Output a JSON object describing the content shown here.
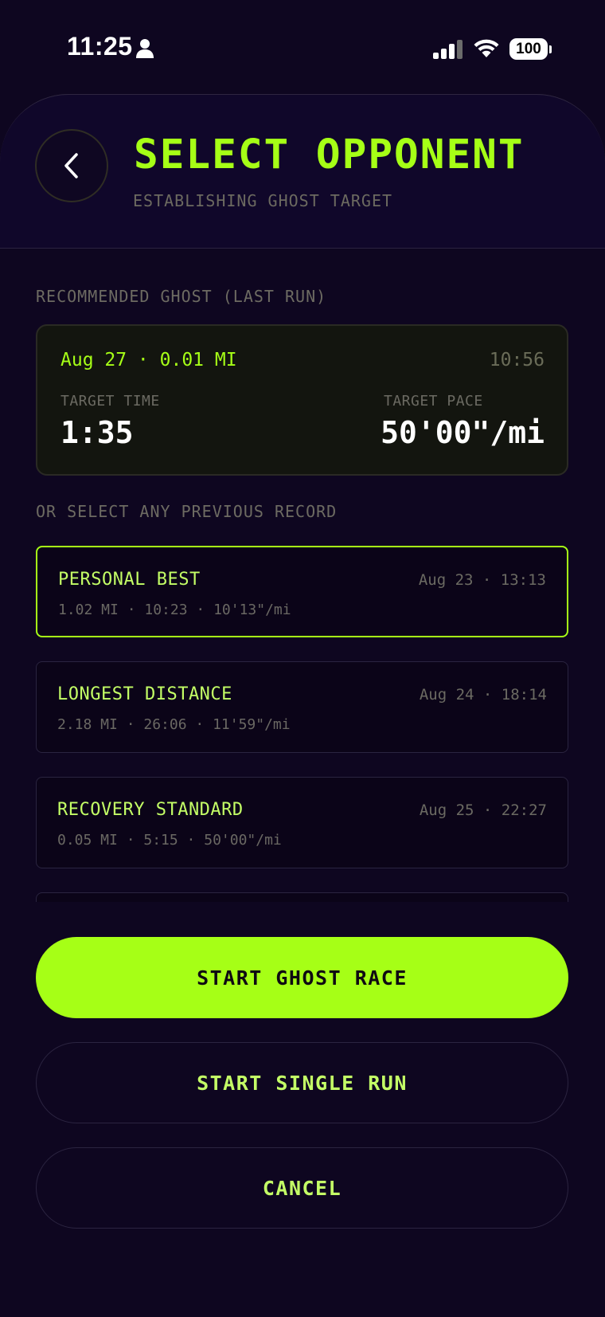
{
  "status_bar": {
    "time": "11:25",
    "battery": "100",
    "icons": [
      "person-icon",
      "cellular-signal-icon",
      "wifi-icon",
      "battery-icon"
    ]
  },
  "header": {
    "title": "SELECT OPPONENT",
    "subtitle": "ESTABLISHING GHOST TARGET",
    "back_icon": "chevron-left-icon"
  },
  "recommended": {
    "section_label": "RECOMMENDED GHOST (LAST RUN)",
    "date_distance": "Aug 27 · 0.01 MI",
    "duration": "10:56",
    "target_time_label": "TARGET TIME",
    "target_time": "1:35",
    "target_pace_label": "TARGET PACE",
    "target_pace": "50'00\"/mi"
  },
  "records": {
    "section_label": "OR SELECT ANY PREVIOUS RECORD",
    "items": [
      {
        "name": "PERSONAL BEST",
        "when": "Aug 23 · 13:13",
        "stats": "1.02 MI · 10:23 · 10'13\"/mi",
        "selected": true
      },
      {
        "name": "LONGEST DISTANCE",
        "when": "Aug 24 · 18:14",
        "stats": "2.18 MI · 26:06 · 11'59\"/mi",
        "selected": false
      },
      {
        "name": "RECOVERY STANDARD",
        "when": "Aug 25 · 22:27",
        "stats": "0.05 MI · 5:15 · 50'00\"/mi",
        "selected": false
      }
    ]
  },
  "actions": {
    "start_ghost_race": "START GHOST RACE",
    "start_single_run": "START SINGLE RUN",
    "cancel": "CANCEL"
  },
  "colors": {
    "background": "#0e0620",
    "accent": "#a6ff16",
    "accent_soft": "#c4ff66",
    "muted_text": "#6b6a62",
    "card_background": "#13150f"
  }
}
